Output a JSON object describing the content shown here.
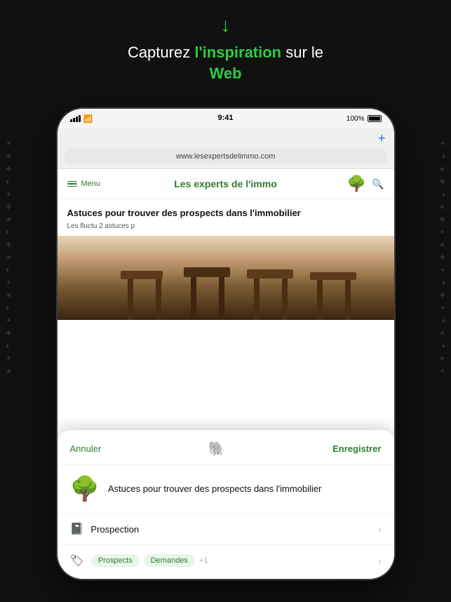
{
  "page": {
    "background_color": "#111111"
  },
  "header": {
    "download_icon": "↓",
    "headline_part1": "Capturez ",
    "headline_bold": "l'inspiration",
    "headline_part2": " sur le ",
    "headline_bold2": "Web"
  },
  "device": {
    "status": {
      "time": "9:41",
      "battery_pct": "100%"
    },
    "browser": {
      "url": "www.lesexpertsdelimmo.com",
      "plus_button": "+"
    },
    "website": {
      "menu_label": "Menu",
      "site_title": "Les experts de l'immo",
      "article_title": "Astuces pour trouver des prospects dans l'immobilier",
      "article_excerpt": "Les fluctu                                                              2\nastuces p"
    },
    "popup": {
      "cancel_label": "Annuler",
      "save_label": "Enregistrer",
      "article_preview_title": "Astuces pour trouver des prospects dans l'immobilier",
      "notebook_label": "Prospection",
      "tag1": "Prospects",
      "tag2": "Demandes",
      "tag_more": "+1"
    }
  }
}
